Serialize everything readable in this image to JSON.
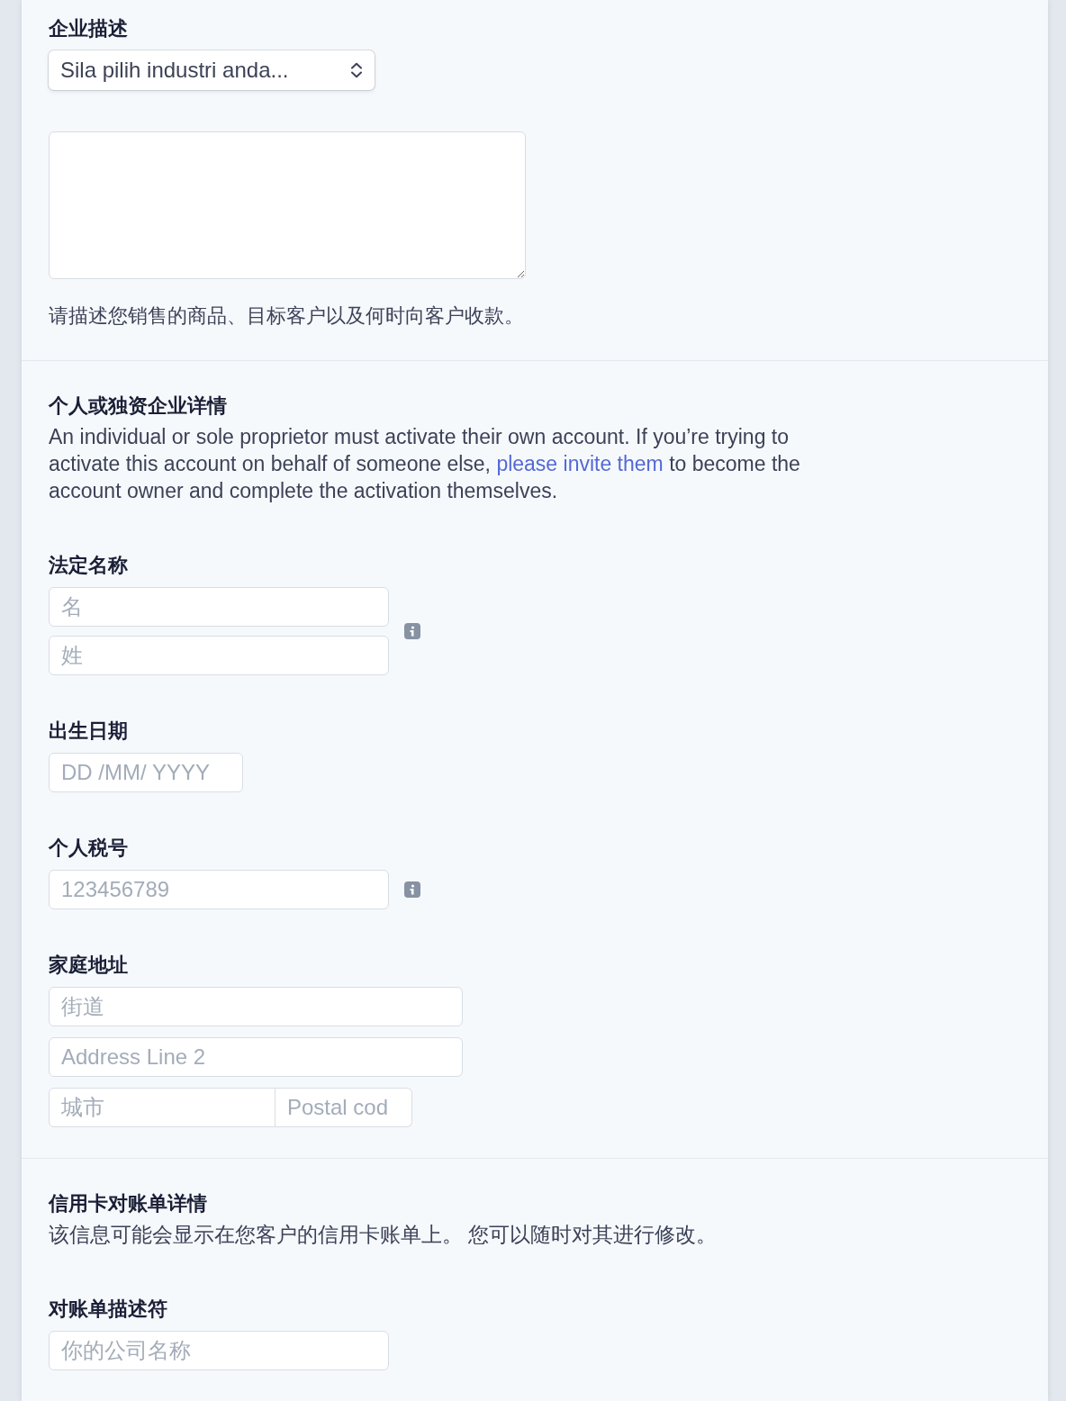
{
  "sections": [
    {
      "fields": [
        {
          "kind": "select",
          "label": "企业描述",
          "value": "Sila pilih industri anda..."
        },
        {
          "kind": "textarea",
          "help": "请描述您销售的商品、目标客户以及何时向客户收款。"
        }
      ]
    },
    {
      "title": "个人或独资企业详情",
      "description": [
        {
          "kind": "text",
          "text": "An individual or sole proprietor must activate their own account. If you’re trying to activate this account on behalf of someone else, "
        },
        {
          "kind": "link",
          "text": "please invite them"
        },
        {
          "kind": "text",
          "text": " to become the account owner and complete the activation themselves."
        }
      ],
      "fields": [
        {
          "kind": "name",
          "label": "法定名称",
          "info": true,
          "rows": [
            [
              {
                "placeholder": "名"
              }
            ],
            [
              {
                "placeholder": "姓"
              }
            ]
          ]
        },
        {
          "kind": "date",
          "label": "出生日期",
          "info": false,
          "rows": [
            [
              {
                "placeholder": "DD /MM/ YYYY"
              }
            ]
          ]
        },
        {
          "kind": "tax-id",
          "label": "个人税号",
          "info": true,
          "rows": [
            [
              {
                "placeholder": "123456789"
              }
            ]
          ]
        },
        {
          "kind": "address",
          "label": "家庭地址",
          "info": false,
          "rows": [
            [
              {
                "placeholder": "街道"
              }
            ],
            [
              {
                "placeholder": "Address Line 2"
              }
            ],
            [
              {
                "placeholder": "城市"
              },
              {
                "placeholder": "Postal cod"
              }
            ]
          ]
        }
      ]
    },
    {
      "title": "信用卡对账单详情",
      "description": [
        {
          "kind": "text",
          "text": "该信息可能会显示在您客户的信用卡账单上。 您可以随时对其进行修改。"
        }
      ],
      "fields": [
        {
          "kind": "descriptor",
          "label": "对账单描述符",
          "info": false,
          "rows": [
            [
              {
                "placeholder": "你的公司名称"
              }
            ]
          ]
        }
      ]
    }
  ]
}
